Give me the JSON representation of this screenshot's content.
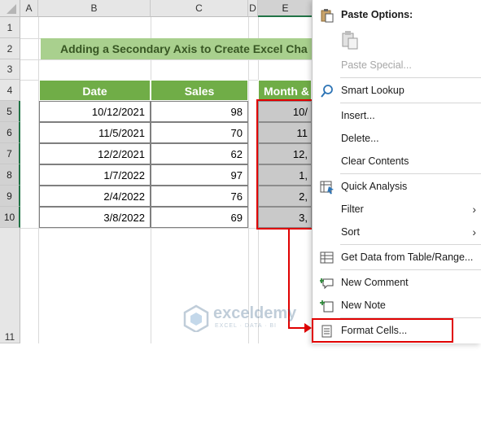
{
  "column_headers": [
    "A",
    "B",
    "C",
    "D",
    "E"
  ],
  "row_headers": [
    "1",
    "2",
    "3",
    "4",
    "5",
    "6",
    "7",
    "8",
    "9",
    "10",
    "11"
  ],
  "title": "Adding a Secondary Axis to Create Excel Cha",
  "table": {
    "headers": [
      "Date",
      "Sales",
      "Month &"
    ],
    "rows": [
      {
        "date": "10/12/2021",
        "sales": "98",
        "partial": "10/"
      },
      {
        "date": "11/5/2021",
        "sales": "70",
        "partial": "11"
      },
      {
        "date": "12/2/2021",
        "sales": "62",
        "partial": "12,"
      },
      {
        "date": "1/7/2022",
        "sales": "97",
        "partial": "1,"
      },
      {
        "date": "2/4/2022",
        "sales": "76",
        "partial": "2,"
      },
      {
        "date": "3/8/2022",
        "sales": "69",
        "partial": "3,"
      }
    ]
  },
  "context_menu": {
    "paste_options": "Paste Options:",
    "paste_special": "Paste Special...",
    "smart_lookup": "Smart Lookup",
    "insert": "Insert...",
    "delete": "Delete...",
    "clear_contents": "Clear Contents",
    "quick_analysis": "Quick Analysis",
    "filter": "Filter",
    "sort": "Sort",
    "get_data": "Get Data from Table/Range...",
    "new_comment": "New Comment",
    "new_note": "New Note",
    "format_cells": "Format Cells..."
  },
  "watermark": {
    "name": "exceldemy",
    "tagline": "EXCEL · DATA · BI"
  },
  "colors": {
    "accent_green": "#70ad47",
    "title_fill": "#a9d08e",
    "highlight_red": "#e00000",
    "selection_gray": "#c9c9c9"
  }
}
